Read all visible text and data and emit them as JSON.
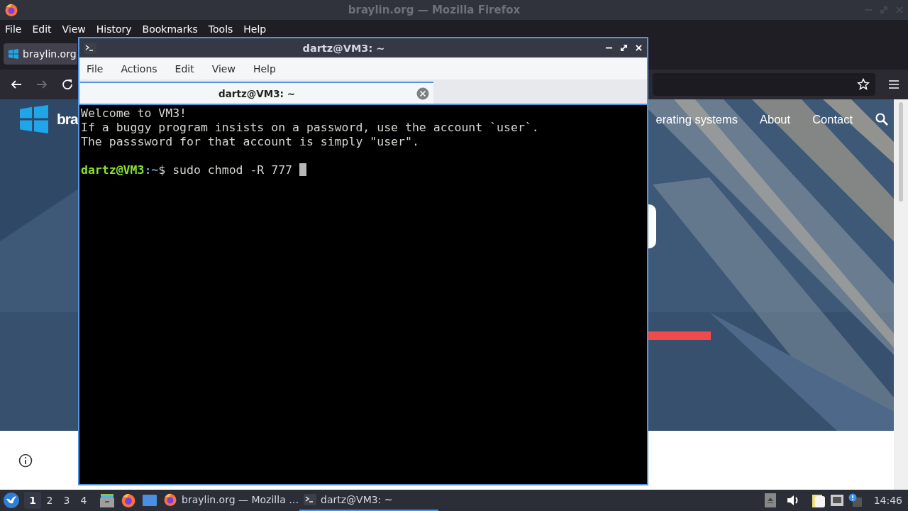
{
  "firefox": {
    "title": "braylin.org — Mozilla Firefox",
    "menu": [
      "File",
      "Edit",
      "View",
      "History",
      "Bookmarks",
      "Tools",
      "Help"
    ],
    "tabs": [
      {
        "label": "braylin.org",
        "selected": true
      }
    ],
    "site": {
      "logo_text": "bra",
      "nav": [
        "erating systems",
        "About",
        "Contact"
      ]
    }
  },
  "terminal": {
    "title": "dartz@VM3: ~",
    "menu": [
      "File",
      "Actions",
      "Edit",
      "View",
      "Help"
    ],
    "tabs": [
      {
        "label": "dartz@VM3: ~",
        "selected": true
      }
    ],
    "lines": [
      {
        "kind": "text",
        "text": "Welcome to VM3!"
      },
      {
        "kind": "text",
        "text": "If a buggy program insists on a password, use the account `user`."
      },
      {
        "kind": "text",
        "text": "The passsword for that account is simply \"user\"."
      },
      {
        "kind": "blank"
      },
      {
        "kind": "prompt",
        "user_host": "dartz@VM3",
        "path": ":~",
        "symbol": "$",
        "command": "sudo chmod -R 777"
      }
    ]
  },
  "taskbar": {
    "workspaces": [
      {
        "label": "1",
        "selected": true
      },
      {
        "label": "2",
        "selected": false
      },
      {
        "label": "3",
        "selected": false
      },
      {
        "label": "4",
        "selected": false
      }
    ],
    "tasks": [
      {
        "label": "braylin.org — Mozilla …",
        "kind": "browser",
        "selected": false
      },
      {
        "label": "dartz@VM3: ~",
        "kind": "terminal",
        "selected": true
      }
    ],
    "clock": "14:46"
  }
}
